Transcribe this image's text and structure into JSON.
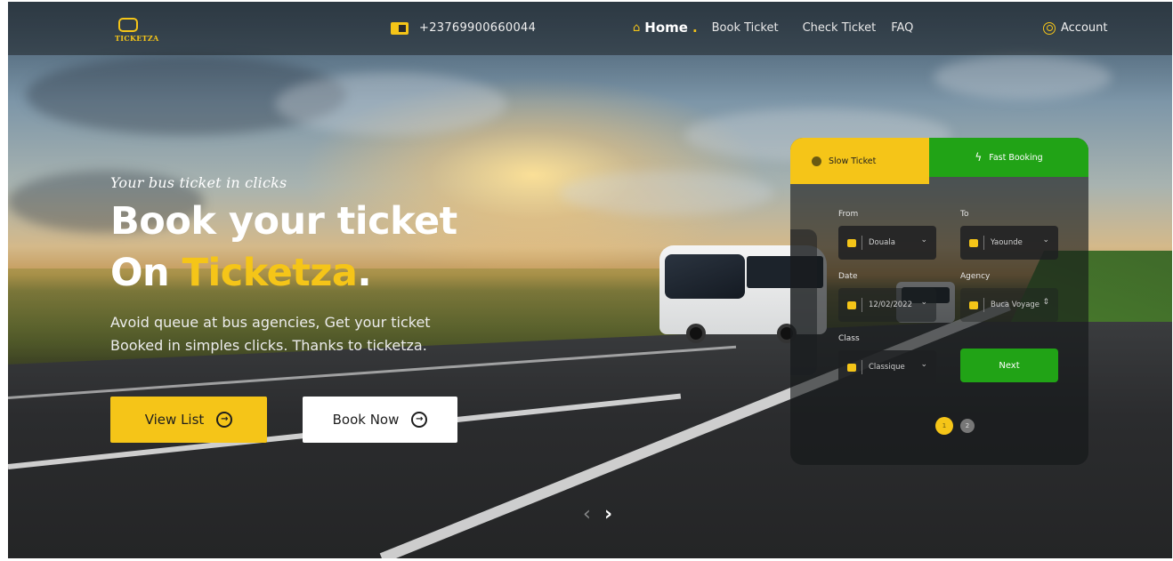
{
  "header": {
    "logo_text": "TICKETZA",
    "phone": "+23769900660044",
    "nav": {
      "home": "Home",
      "home_dot": ".",
      "book": "Book Ticket",
      "check": "Check Ticket",
      "faq": "FAQ"
    },
    "account": "Account"
  },
  "hero": {
    "tagline": "Your bus ticket in clicks",
    "title_line1": "Book your ticket",
    "title_on": "On ",
    "title_brand": "Ticketza",
    "title_dot": ".",
    "desc_line1": "Avoid queue at bus agencies, Get your ticket",
    "desc_line2": "Booked in simples clicks. Thanks to ticketza.",
    "btn_view_list": "View List",
    "btn_book_now": "Book Now",
    "arrow": "→",
    "prev": "‹",
    "next": "›"
  },
  "booking": {
    "tab_slow": "Slow Ticket",
    "tab_fast": "Fast Booking",
    "from_label": "From",
    "from_value": "Douala",
    "to_label": "To",
    "to_value": "Yaounde",
    "date_label": "Date",
    "date_value": "12/02/2022",
    "agency_label": "Agency",
    "agency_value": "Buca Voyage",
    "class_label": "Class",
    "class_value": "Classique",
    "next": "Next",
    "page1": "1",
    "page2": "2",
    "chevron": "⌄",
    "updown": "⇕"
  },
  "colors": {
    "accent": "#f5c518",
    "green": "#21a316"
  }
}
